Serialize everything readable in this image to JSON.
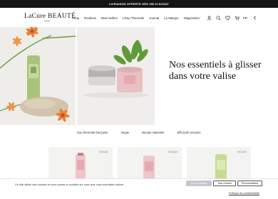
{
  "topbar": {
    "text": "LIVRAISON OFFERTE DÈS 35€ D'ACHAT"
  },
  "header": {
    "logo": "LaCure BEAUTÉ",
    "nav": [
      "Shop",
      "Routines",
      "Best Sellers",
      "L'Eau Thermale",
      "Journal",
      "La Marque",
      "Diagnostics"
    ],
    "lang": "FR",
    "icons": [
      "user-icon",
      "search-icon",
      "heart-icon",
      "cart-icon",
      "chevron-icon"
    ]
  },
  "hero": {
    "title": "Nos essentiels à glisser dans votre valise"
  },
  "categories": [
    "Eau thermale française",
    "Vegan",
    "Beauté Naturelle",
    "Efficacité prouvée"
  ],
  "products": [
    {
      "badge": "VEGAN"
    },
    {
      "badge": "VEGAN"
    },
    {
      "badge": "VEGAN"
    }
  ],
  "cookie": {
    "text": "Ce site utilise des cookies et vous donne le contrôle sur ceux que vous souhaitez activer",
    "accept": "Tout accepter",
    "refuse": "Tout refuser",
    "customize": "Personnaliser",
    "policy": "Politique de confidentialité"
  },
  "colors": {
    "topbar": "#141414",
    "tube_green": "#a8c47a",
    "pink": "#e9c0c4",
    "accept_button": "#c9c3ce"
  }
}
